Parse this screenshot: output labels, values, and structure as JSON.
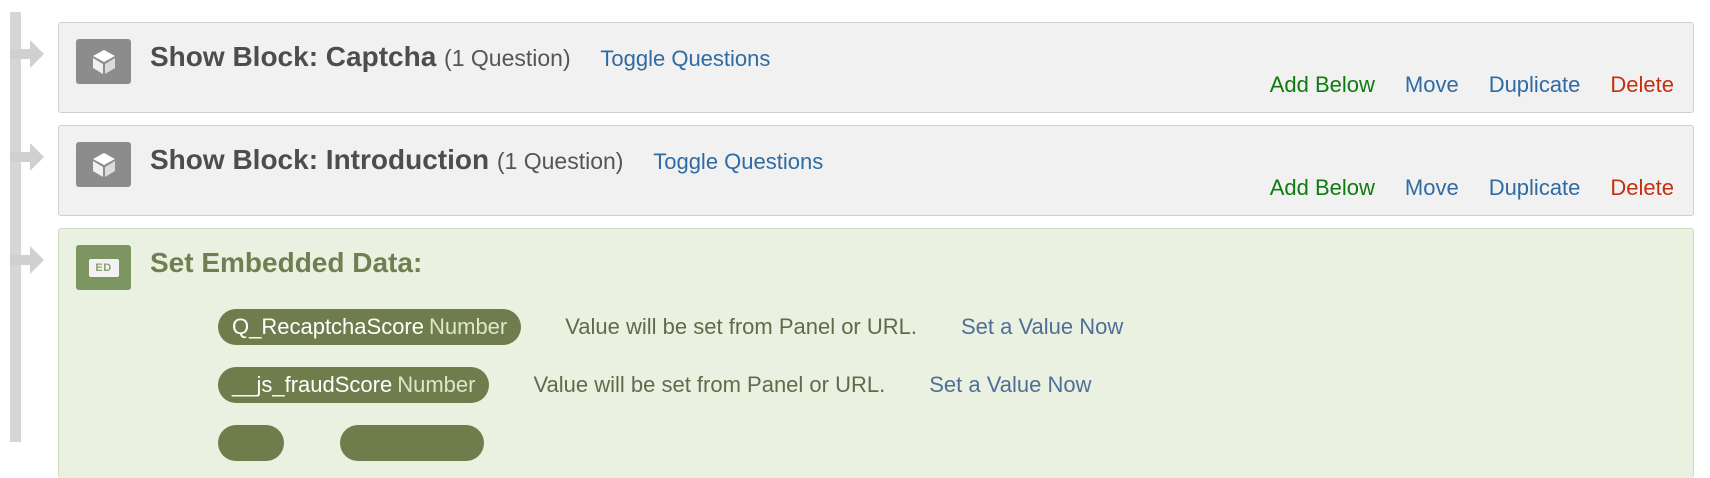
{
  "blocks": [
    {
      "prefix": "Show Block: ",
      "name": "Captcha",
      "count": "(1 Question)",
      "toggle": "Toggle Questions",
      "actions": {
        "add_below": "Add Below",
        "move": "Move",
        "duplicate": "Duplicate",
        "delete": "Delete"
      }
    },
    {
      "prefix": "Show Block: ",
      "name": "Introduction",
      "count": "(1 Question)",
      "toggle": "Toggle Questions",
      "actions": {
        "add_below": "Add Below",
        "move": "Move",
        "duplicate": "Duplicate",
        "delete": "Delete"
      }
    }
  ],
  "embedded": {
    "icon_label": "ED",
    "title": "Set Embedded Data:",
    "fields": [
      {
        "name": "Q_RecaptchaScore",
        "type": "Number",
        "note": "Value will be set from Panel or URL.",
        "action": "Set a Value Now"
      },
      {
        "name": "__js_fraudScore",
        "type": "Number",
        "note": "Value will be set from Panel or URL.",
        "action": "Set a Value Now"
      }
    ]
  },
  "icons": {
    "block": "cube-icon",
    "embedded": "embedded-data-icon",
    "flow": "flow-arrow-icon"
  },
  "colors": {
    "add_below": "#0f7a0f",
    "link": "#2f6ba3",
    "delete": "#c23010",
    "embedded_bg": "#eaf1e1",
    "pill": "#6e7d4b"
  }
}
